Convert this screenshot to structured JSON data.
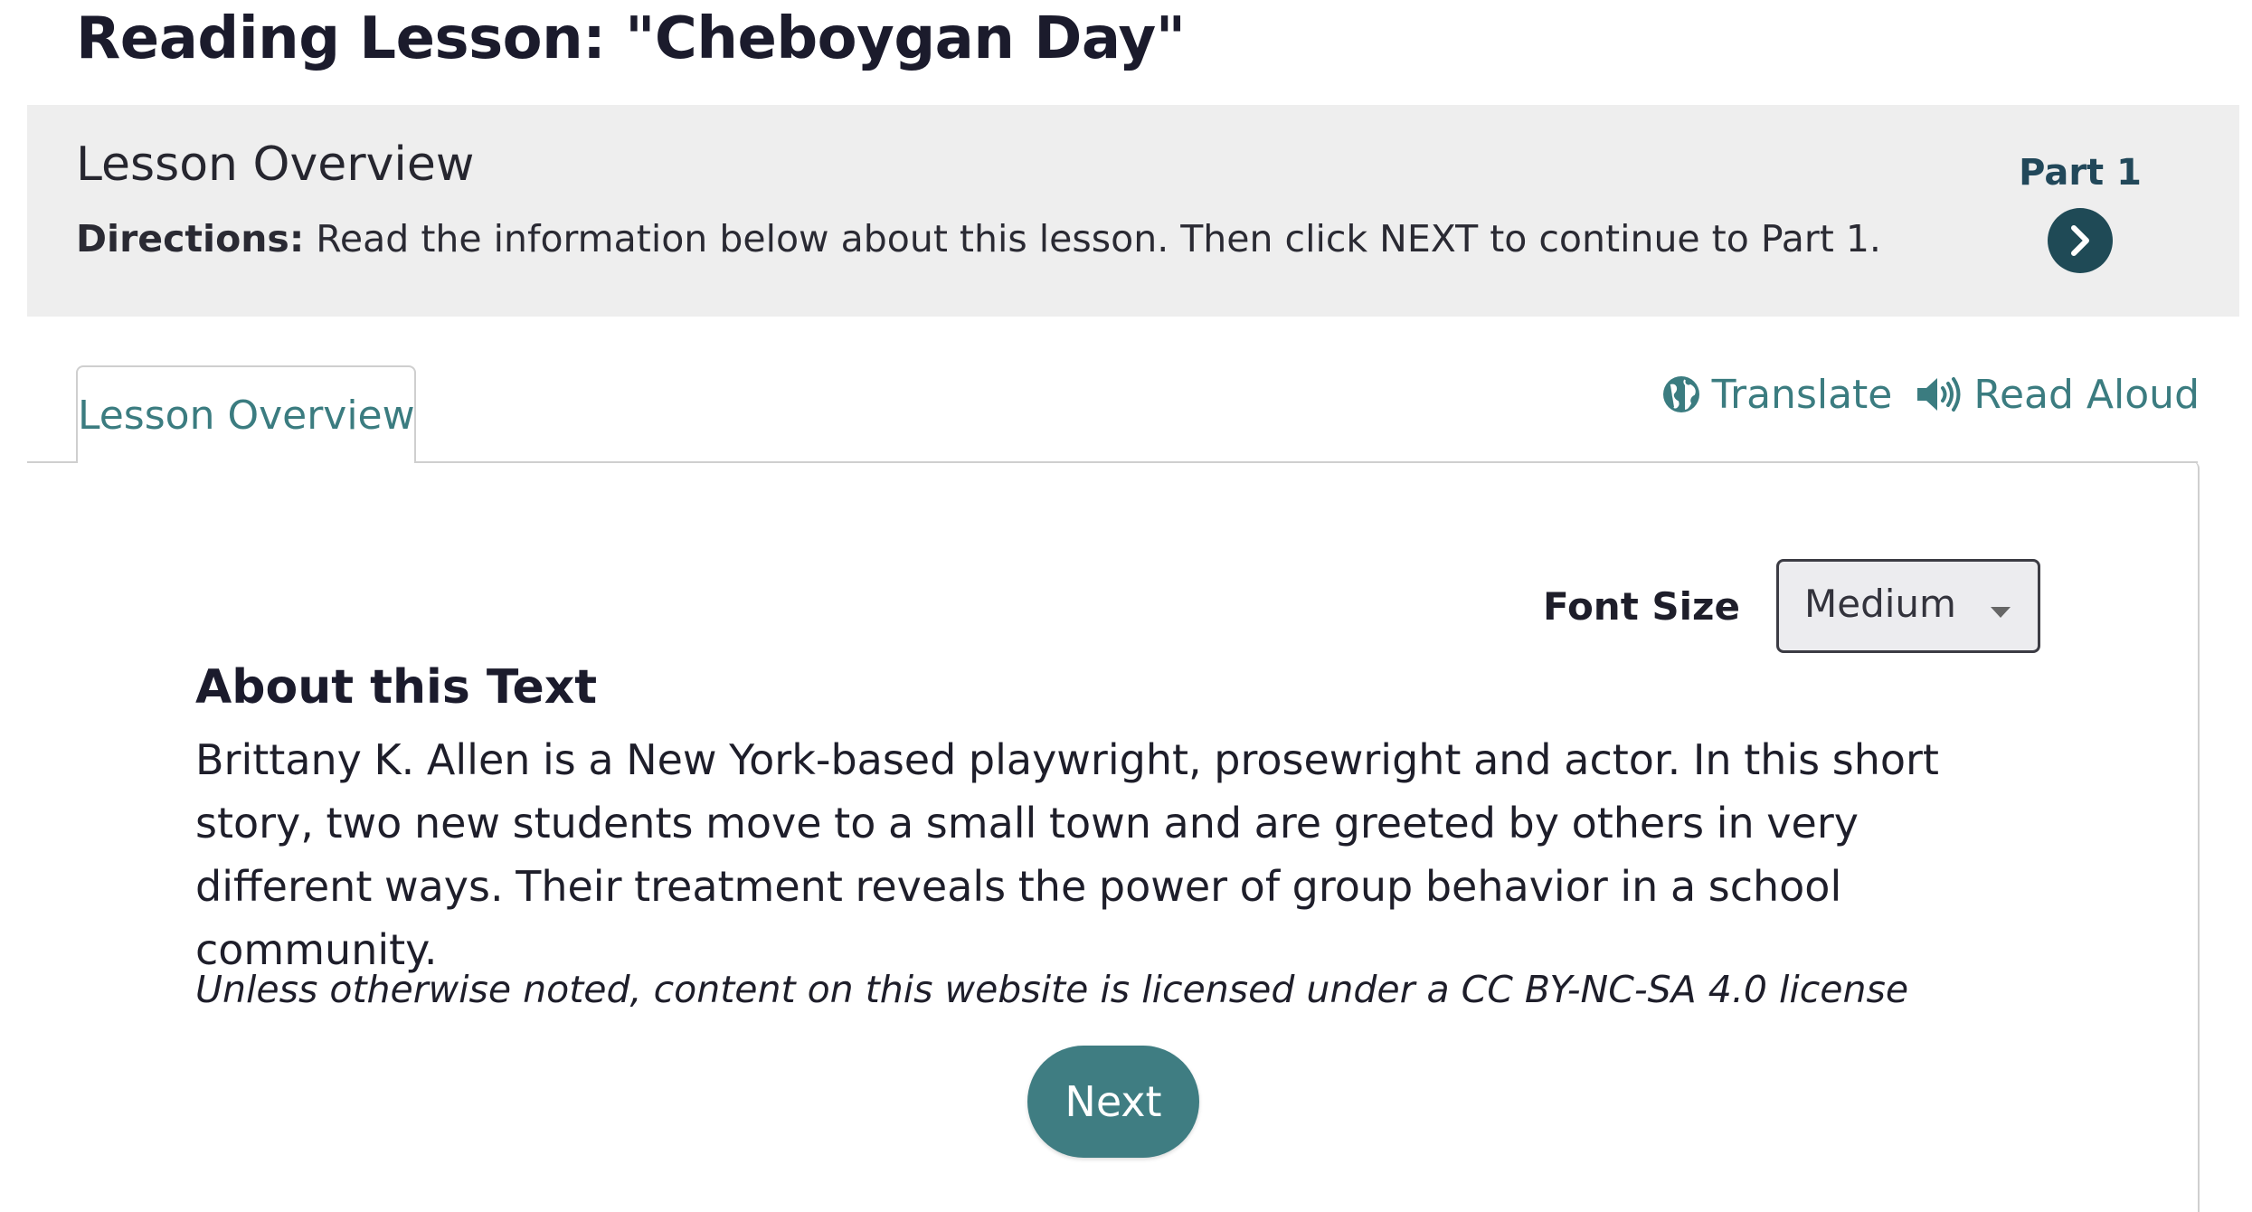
{
  "page": {
    "title": "Reading Lesson: \"Cheboygan Day\""
  },
  "banner": {
    "heading": "Lesson Overview",
    "directions_label": "Directions:",
    "directions_text": "Read the information below about this lesson. Then click NEXT to continue to Part 1.",
    "part_label": "Part 1",
    "part_next_icon": "chevron-right-icon"
  },
  "tabs": [
    {
      "label": "Lesson Overview",
      "active": true
    }
  ],
  "tools": {
    "translate_label": "Translate",
    "translate_icon": "globe-icon",
    "read_aloud_label": "Read Aloud",
    "read_aloud_icon": "speaker-icon"
  },
  "font_size": {
    "label": "Font Size",
    "selected": "Medium"
  },
  "about": {
    "heading": "About this Text",
    "body": "Brittany K. Allen is a New York-based playwright, prosewright and actor. In this short story, two new students move to a small town and are greeted by others in very different ways. Their treatment reveals the power of group behavior in a school community.",
    "license": "Unless otherwise noted, content on this website is licensed under a CC BY-NC-SA 4.0 license"
  },
  "next_button": {
    "label": "Next"
  },
  "colors": {
    "accent": "#3f7d82",
    "dark_accent": "#1f4a56",
    "banner_bg": "#eeeeee"
  }
}
